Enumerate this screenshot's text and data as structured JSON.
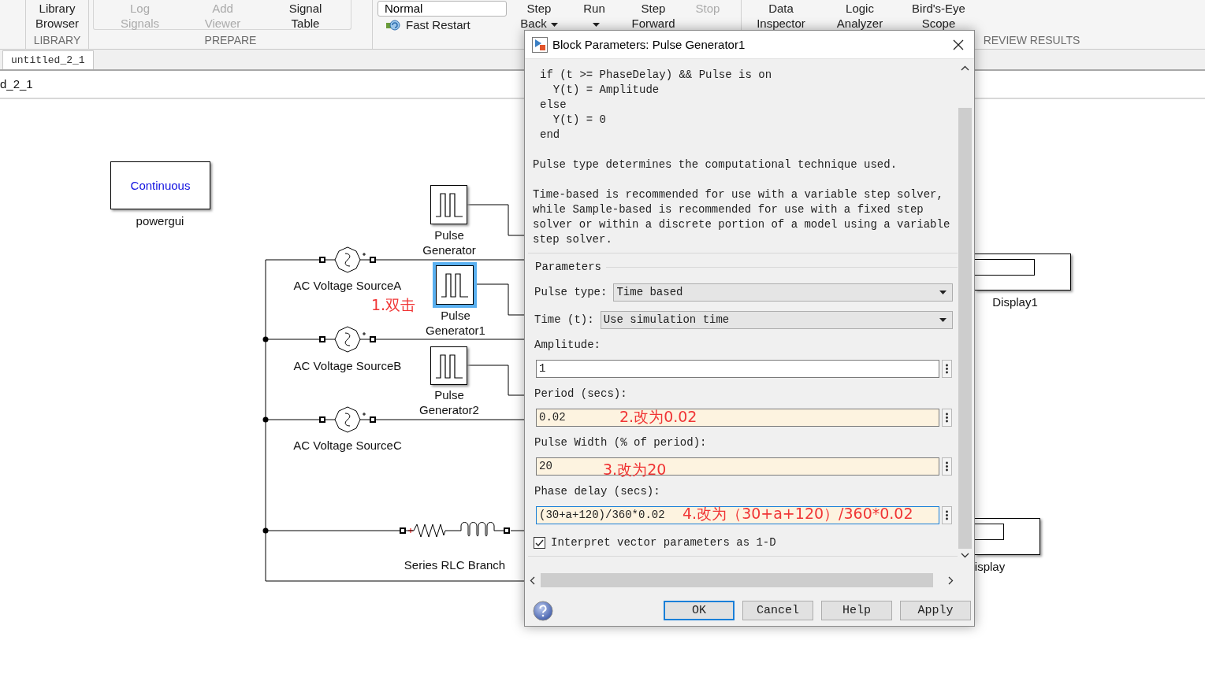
{
  "toolstrip": {
    "sections": [
      {
        "title": "LIBRARY",
        "items": [
          {
            "kind": "button",
            "label": "Library Browser",
            "disabled": false,
            "menu": false
          }
        ]
      },
      {
        "title": "PREPARE",
        "items": [
          {
            "kind": "button",
            "label": "Log Signals",
            "disabled": true,
            "menu": false
          },
          {
            "kind": "button",
            "label": "Add Viewer",
            "disabled": true,
            "menu": false
          },
          {
            "kind": "button",
            "label": "Signal Table",
            "disabled": false,
            "menu": false
          }
        ]
      },
      {
        "items": [
          {
            "kind": "mode",
            "value": "Normal",
            "label": "Fast Restart"
          },
          {
            "kind": "button",
            "label": "Step Back",
            "disabled": false,
            "menu": true
          },
          {
            "kind": "button",
            "label": "Run",
            "disabled": false,
            "menu": true
          },
          {
            "kind": "button",
            "label": "Step Forward",
            "disabled": false,
            "menu": false
          },
          {
            "kind": "button",
            "label": "Stop",
            "disabled": true,
            "menu": false
          }
        ]
      },
      {
        "title": "REVIEW RESULTS",
        "items": [
          {
            "kind": "button",
            "label": "Data Inspector",
            "disabled": false,
            "menu": false
          },
          {
            "kind": "button",
            "label": "Logic Analyzer",
            "disabled": false,
            "menu": false
          },
          {
            "kind": "button",
            "label": "Bird's-Eye Scope",
            "disabled": false,
            "menu": false
          }
        ]
      }
    ]
  },
  "model": {
    "tab": {
      "label": "untitled_2_1",
      "selected": true
    },
    "breadcrumb": "d_2_1",
    "blocks": [
      {
        "kind": "powergui",
        "text": "Continuous",
        "label": "powergui"
      },
      {
        "kind": "pulse",
        "label": "Pulse Generator",
        "selected": false
      },
      {
        "kind": "ac_source",
        "label": "AC Voltage SourceA"
      },
      {
        "kind": "display",
        "label": "Display1"
      },
      {
        "kind": "pulse",
        "label": "Pulse Generator1",
        "selected": true
      },
      {
        "kind": "ac_source",
        "label": "AC Voltage SourceB"
      },
      {
        "kind": "pulse",
        "label": "Pulse Generator2",
        "selected": false
      },
      {
        "kind": "ac_source",
        "label": "AC Voltage SourceC"
      },
      {
        "kind": "rlc",
        "label": "Series RLC Branch"
      },
      {
        "kind": "display",
        "label": "isplay"
      }
    ],
    "annotation": "1.双击"
  },
  "dialog": {
    "title": "Block Parameters: Pulse Generator1",
    "code": [
      "if (t >= PhaseDelay) && Pulse is on",
      "  Y(t) = Amplitude",
      "else",
      "  Y(t) = 0",
      "end"
    ],
    "paragraphs": [
      "Pulse type determines the computational technique used.",
      "Time-based is recommended for use with a variable step solver, while Sample-based is recommended for use with a fixed step solver or within a discrete portion of a model using a variable step solver."
    ],
    "group": "Parameters",
    "params": [
      {
        "kind": "dropdown",
        "label": "Pulse type:",
        "value": "Time based"
      },
      {
        "kind": "dropdown",
        "label": "Time (t):",
        "value": "Use simulation time"
      },
      {
        "kind": "text",
        "label": "Amplitude:",
        "value": "1",
        "modified": false,
        "focused": false
      },
      {
        "kind": "text",
        "label": "Period (secs):",
        "value": "0.02",
        "modified": true,
        "focused": false,
        "annotation": "2.改为0.02"
      },
      {
        "kind": "text",
        "label": "Pulse Width (% of period):",
        "value": "20",
        "modified": true,
        "focused": false,
        "annotation": "3.改为20"
      },
      {
        "kind": "text",
        "label": "Phase delay (secs):",
        "value": "(30+a+120)/360*0.02",
        "modified": true,
        "focused": true,
        "annotation": "4.改为（30+a+120）/360*0.02"
      },
      {
        "kind": "checkbox",
        "label": "Interpret vector parameters as 1-D",
        "checked": true
      }
    ],
    "buttons": [
      {
        "label": "OK",
        "default": true
      },
      {
        "label": "Cancel",
        "default": false
      },
      {
        "label": "Help",
        "default": false
      },
      {
        "label": "Apply",
        "default": false
      }
    ]
  }
}
